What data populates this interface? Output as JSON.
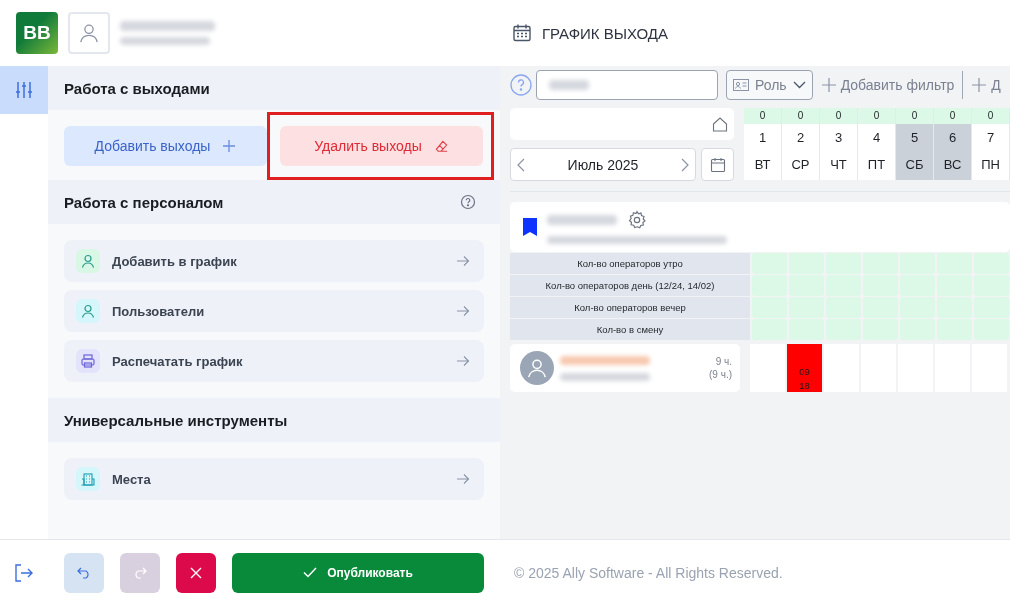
{
  "app": {
    "logo": "BB",
    "title": "ГРАФИК ВЫХОДА"
  },
  "panel": {
    "sections": [
      {
        "title": "Работа с выходами",
        "help": false,
        "kind": "buttons",
        "buttons": [
          {
            "label": "Добавить выходы",
            "kind": "add",
            "highlighted": false
          },
          {
            "label": "Удалить выходы",
            "kind": "delete",
            "highlighted": true
          }
        ]
      },
      {
        "title": "Работа с персоналом",
        "help": true,
        "kind": "links",
        "links": [
          {
            "label": "Добавить в график",
            "kind": "person",
            "color": "#d9f7e5"
          },
          {
            "label": "Пользователи",
            "kind": "person",
            "color": "#d5f6fb"
          },
          {
            "label": "Распечатать график",
            "kind": "printer",
            "color": "#e3e4fb"
          }
        ]
      },
      {
        "title": "Универсальные инструменты",
        "help": false,
        "kind": "links",
        "links": [
          {
            "label": "Места",
            "kind": "building",
            "color": "#d5f6fb"
          }
        ]
      }
    ]
  },
  "actions": {
    "publish": "Опубликовать"
  },
  "filters": {
    "role": "Роль",
    "add_filter": "Добавить фильтр",
    "cut_filter": "Д"
  },
  "calendar": {
    "month": "Июль 2025",
    "days": [
      {
        "count": "0",
        "date": "1",
        "weekday": "ВТ",
        "weekend": false
      },
      {
        "count": "0",
        "date": "2",
        "weekday": "СР",
        "weekend": false
      },
      {
        "count": "0",
        "date": "3",
        "weekday": "ЧТ",
        "weekend": false
      },
      {
        "count": "0",
        "date": "4",
        "weekday": "ПТ",
        "weekend": false
      },
      {
        "count": "0",
        "date": "5",
        "weekday": "СБ",
        "weekend": true
      },
      {
        "count": "0",
        "date": "6",
        "weekday": "ВС",
        "weekend": true
      },
      {
        "count": "0",
        "date": "7",
        "weekday": "ПН",
        "weekend": false
      }
    ],
    "metrics": [
      "Кол-во операторов утро",
      "Кол-во операторов день (12/24, 14/02)",
      "Кол-во операторов вечер",
      "Кол-во в смену"
    ],
    "employees": [
      {
        "hours": "9 ч.",
        "planned": "(9 ч.)",
        "shifts": [
          {
            "filled": false
          },
          {
            "filled": true,
            "start": "09",
            "end": "18"
          },
          {
            "filled": false
          },
          {
            "filled": false
          },
          {
            "filled": false
          },
          {
            "filled": false
          },
          {
            "filled": false
          }
        ]
      }
    ]
  },
  "footer": {
    "copyright": "© 2025 Ally Software - All Rights Reserved."
  }
}
